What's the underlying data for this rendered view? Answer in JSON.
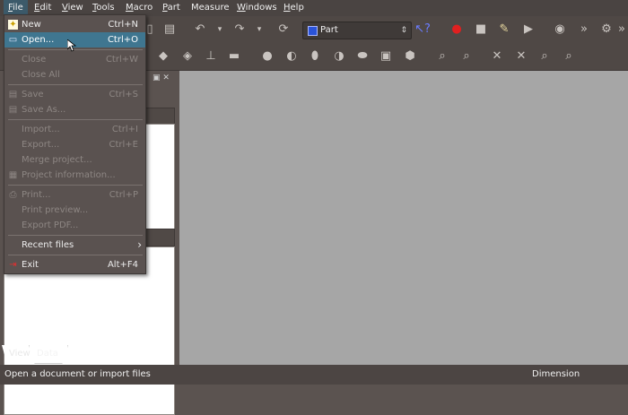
{
  "menubar": {
    "items": [
      {
        "label": "File",
        "accel": "F",
        "rest": "ile"
      },
      {
        "label": "Edit",
        "accel": "E",
        "rest": "dit"
      },
      {
        "label": "View",
        "accel": "V",
        "rest": "iew"
      },
      {
        "label": "Tools",
        "accel": "T",
        "rest": "ools"
      },
      {
        "label": "Macro",
        "accel": "M",
        "rest": "acro"
      },
      {
        "label": "Part",
        "accel": "P",
        "rest": "art"
      },
      {
        "label": "Measure",
        "accel": "",
        "rest": "Measure"
      },
      {
        "label": "Windows",
        "accel": "W",
        "rest": "indows"
      },
      {
        "label": "Help",
        "accel": "H",
        "rest": "elp"
      }
    ]
  },
  "toolbar": {
    "workbench": "Part",
    "more_glyph": "»"
  },
  "file_menu": {
    "items": [
      {
        "label": "New",
        "shortcut": "Ctrl+N",
        "icon": "new-document-icon",
        "enabled": true
      },
      {
        "label": "Open...",
        "shortcut": "Ctrl+O",
        "icon": "open-folder-icon",
        "enabled": true,
        "highlighted": true
      },
      {
        "label": "Close",
        "shortcut": "Ctrl+W",
        "enabled": false
      },
      {
        "label": "Close All",
        "shortcut": "",
        "enabled": false
      },
      {
        "label": "Save",
        "shortcut": "Ctrl+S",
        "icon": "save-icon",
        "enabled": false
      },
      {
        "label": "Save As...",
        "shortcut": "",
        "icon": "save-as-icon",
        "enabled": false
      },
      {
        "label": "Import...",
        "shortcut": "Ctrl+I",
        "enabled": false
      },
      {
        "label": "Export...",
        "shortcut": "Ctrl+E",
        "enabled": false
      },
      {
        "label": "Merge project...",
        "shortcut": "",
        "enabled": false
      },
      {
        "label": "Project information...",
        "shortcut": "",
        "icon": "project-info-icon",
        "enabled": false
      },
      {
        "label": "Print...",
        "shortcut": "Ctrl+P",
        "icon": "print-icon",
        "enabled": false
      },
      {
        "label": "Print preview...",
        "shortcut": "",
        "enabled": false
      },
      {
        "label": "Export PDF...",
        "shortcut": "",
        "enabled": false
      },
      {
        "label": "Recent files",
        "shortcut": "",
        "enabled": true,
        "submenu": true
      },
      {
        "label": "Exit",
        "shortcut": "Alt+F4",
        "icon": "exit-icon",
        "enabled": true
      }
    ]
  },
  "tabs": [
    {
      "label": "View"
    },
    {
      "label": "Data"
    }
  ],
  "statusbar": {
    "message": "Open a document or import files",
    "units": "Dimension"
  }
}
